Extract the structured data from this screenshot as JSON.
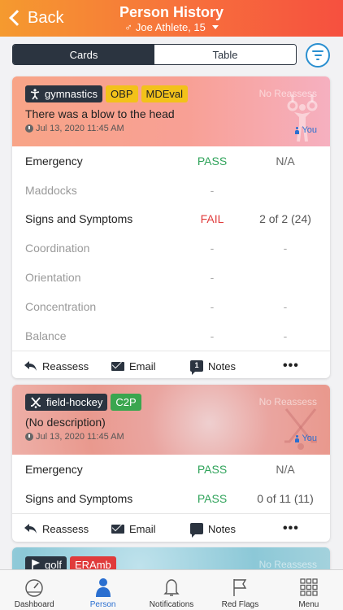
{
  "header": {
    "back_label": "Back",
    "title": "Person History",
    "subtitle": "Joe Athlete, 15",
    "gender_symbol": "♂"
  },
  "segmented": {
    "cards_label": "Cards",
    "table_label": "Table",
    "selected": "Cards"
  },
  "cards": [
    {
      "sport": "gymnastics",
      "tags": [
        "OBP",
        "MDEval"
      ],
      "no_reassess": "No Reassess",
      "description": "There was a blow to the head",
      "date": "Jul 13, 2020 11:45 AM",
      "author": "You",
      "rows": [
        {
          "name": "Emergency",
          "result": "PASS",
          "count": "N/A",
          "dim": false
        },
        {
          "name": "Maddocks",
          "result": "-",
          "count": "",
          "dim": true
        },
        {
          "name": "Signs and Symptoms",
          "result": "FAIL",
          "count": "2 of 2 (24)",
          "dim": false
        },
        {
          "name": "Coordination",
          "result": "-",
          "count": "-",
          "dim": true
        },
        {
          "name": "Orientation",
          "result": "-",
          "count": "",
          "dim": true
        },
        {
          "name": "Concentration",
          "result": "-",
          "count": "-",
          "dim": true
        },
        {
          "name": "Balance",
          "result": "-",
          "count": "-",
          "dim": true
        }
      ],
      "actions": {
        "reassess": "Reassess",
        "email": "Email",
        "notes": "Notes",
        "notes_count": "1",
        "more": "•••"
      }
    },
    {
      "sport": "field-hockey",
      "tags": [
        "C2P"
      ],
      "no_reassess": "No Reassess",
      "description": "(No description)",
      "date": "Jul 13, 2020 11:45 AM",
      "author": "You",
      "rows": [
        {
          "name": "Emergency",
          "result": "PASS",
          "count": "N/A",
          "dim": false
        },
        {
          "name": "Signs and Symptoms",
          "result": "PASS",
          "count": "0 of 11 (11)",
          "dim": false
        }
      ],
      "actions": {
        "reassess": "Reassess",
        "email": "Email",
        "notes": "Notes",
        "more": "•••"
      }
    },
    {
      "sport": "golf",
      "tags": [
        "ERAmb"
      ],
      "no_reassess": "No Reassess"
    }
  ],
  "tabbar": [
    {
      "label": "Dashboard",
      "icon": "gauge-icon"
    },
    {
      "label": "Person",
      "icon": "person-icon"
    },
    {
      "label": "Notifications",
      "icon": "bell-icon"
    },
    {
      "label": "Red Flags",
      "icon": "flag-icon"
    },
    {
      "label": "Menu",
      "icon": "grid-icon"
    }
  ],
  "colors": {
    "header_start": "#f59a2f",
    "header_end": "#f6503f",
    "pass": "#2fa35a",
    "fail": "#e03b3b",
    "accent": "#2a6fd0",
    "dark": "#2b3440"
  }
}
